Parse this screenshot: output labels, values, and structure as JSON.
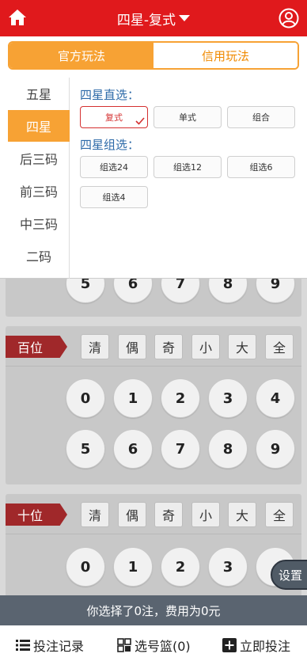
{
  "header": {
    "title": "四星-复式"
  },
  "mode_tabs": {
    "official": "官方玩法",
    "credit": "信用玩法"
  },
  "sidebar": [
    "五星",
    "四星",
    "后三码",
    "前三码",
    "中三码",
    "二码"
  ],
  "groups": {
    "direct_title": "四星直选：",
    "direct": [
      "复式",
      "单式",
      "组合"
    ],
    "combo_title": "四星组选：",
    "combo": [
      "组选24",
      "组选12",
      "组选6",
      "组选4"
    ]
  },
  "partial_row": [
    "5",
    "6",
    "7",
    "8",
    "9"
  ],
  "positions": [
    {
      "label": "百位",
      "filters": [
        "清",
        "偶",
        "奇",
        "小",
        "大",
        "全"
      ],
      "row1": [
        "0",
        "1",
        "2",
        "3",
        "4"
      ],
      "row2": [
        "5",
        "6",
        "7",
        "8",
        "9"
      ]
    },
    {
      "label": "十位",
      "filters": [
        "清",
        "偶",
        "奇",
        "小",
        "大",
        "全"
      ],
      "row1": [
        "0",
        "1",
        "2",
        "3"
      ]
    }
  ],
  "settings_label": "设置",
  "status_text": "你选择了0注，费用为0元",
  "bottom": {
    "records": "投注记录",
    "basket": "选号篮(0)",
    "bet": "立即投注"
  },
  "colors": {
    "header": "#e0191c",
    "accent": "#f7a234",
    "position_label": "#a0282a",
    "status_bar": "#5a6470"
  }
}
